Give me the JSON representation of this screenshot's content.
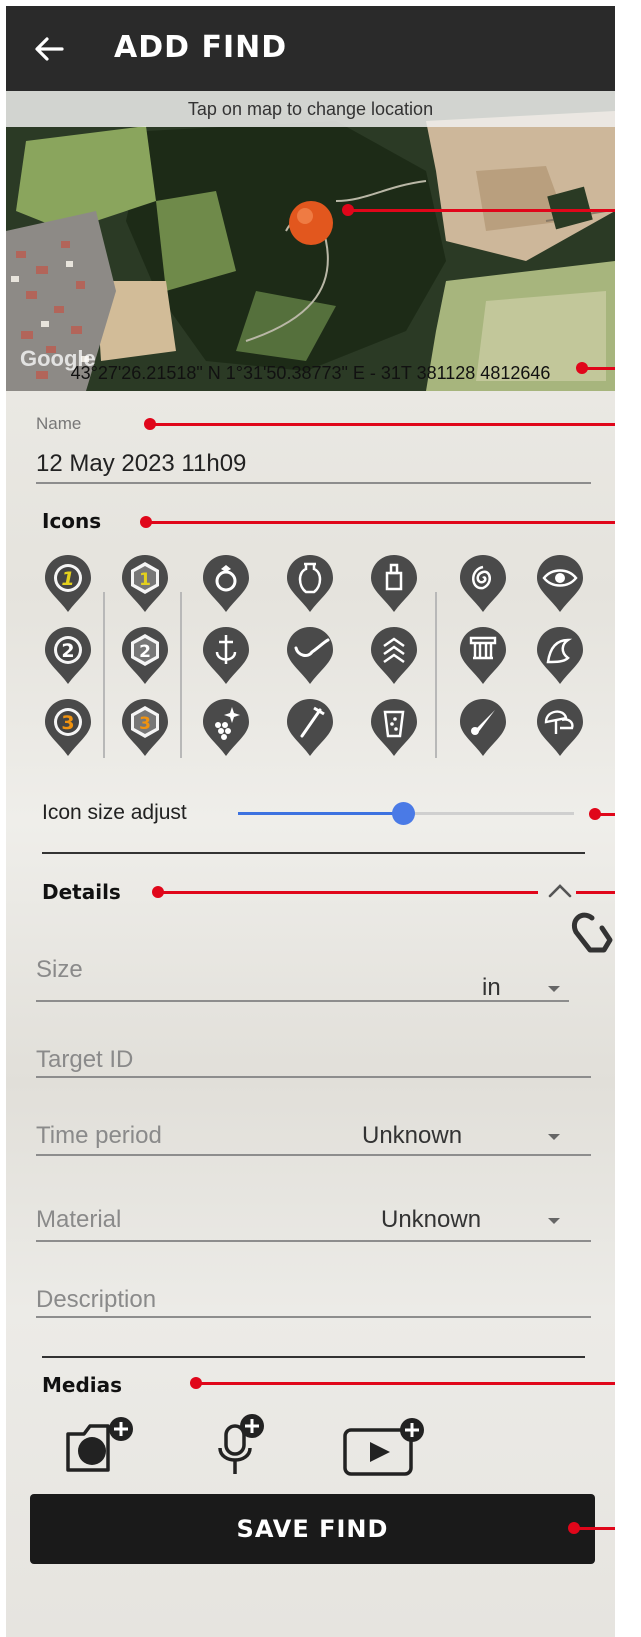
{
  "header": {
    "title": "ADD FIND",
    "back_icon": "arrow-left-icon"
  },
  "map": {
    "hint": "Tap on map to change location",
    "watermark": "Google",
    "coordinates": "43°27'26.21518\" N 1°31'50.38773\" E - 31T 381128 4812646",
    "marker_color": "#e2571e"
  },
  "name_field": {
    "label": "Name",
    "value": "12 May 2023 11h09"
  },
  "icons_section": {
    "title": "Icons",
    "icons": [
      "number-1-circle-yellow-icon",
      "number-2-circle-icon",
      "number-3-circle-orange-icon",
      "number-1-hexagon-yellow-icon",
      "number-2-hexagon-icon",
      "number-3-hexagon-orange-icon",
      "ring-icon",
      "cross-icon",
      "sparkle-grapes-icon",
      "amphora-icon",
      "spoon-icon",
      "pickaxe-icon",
      "weight-icon",
      "chevrons-up-icon",
      "glass-icon",
      "ammonite-icon",
      "column-icon",
      "arrowhead-icon",
      "eye-icon",
      "shell-icon",
      "mushroom-icon"
    ],
    "size_adjust_label": "Icon size adjust",
    "size_adjust_level": 0.49
  },
  "details_section": {
    "title": "Details",
    "collapse_icon": "chevron-up-icon",
    "size_placeholder": "Size",
    "size_unit": "in",
    "target_id_placeholder": "Target ID",
    "time_period_label": "Time period",
    "time_period_value": "Unknown",
    "material_label": "Material",
    "material_value": "Unknown",
    "description_placeholder": "Description"
  },
  "medias_section": {
    "title": "Medias",
    "add_photo_icon": "camera-plus-icon",
    "add_audio_icon": "microphone-plus-icon",
    "add_video_icon": "video-plus-icon"
  },
  "save_button": {
    "label": "SAVE FIND"
  },
  "colors": {
    "header": "#2a2a2a",
    "accent_slider": "#3d72e0",
    "callout": "#e0061a",
    "button": "#1a1a1a"
  }
}
